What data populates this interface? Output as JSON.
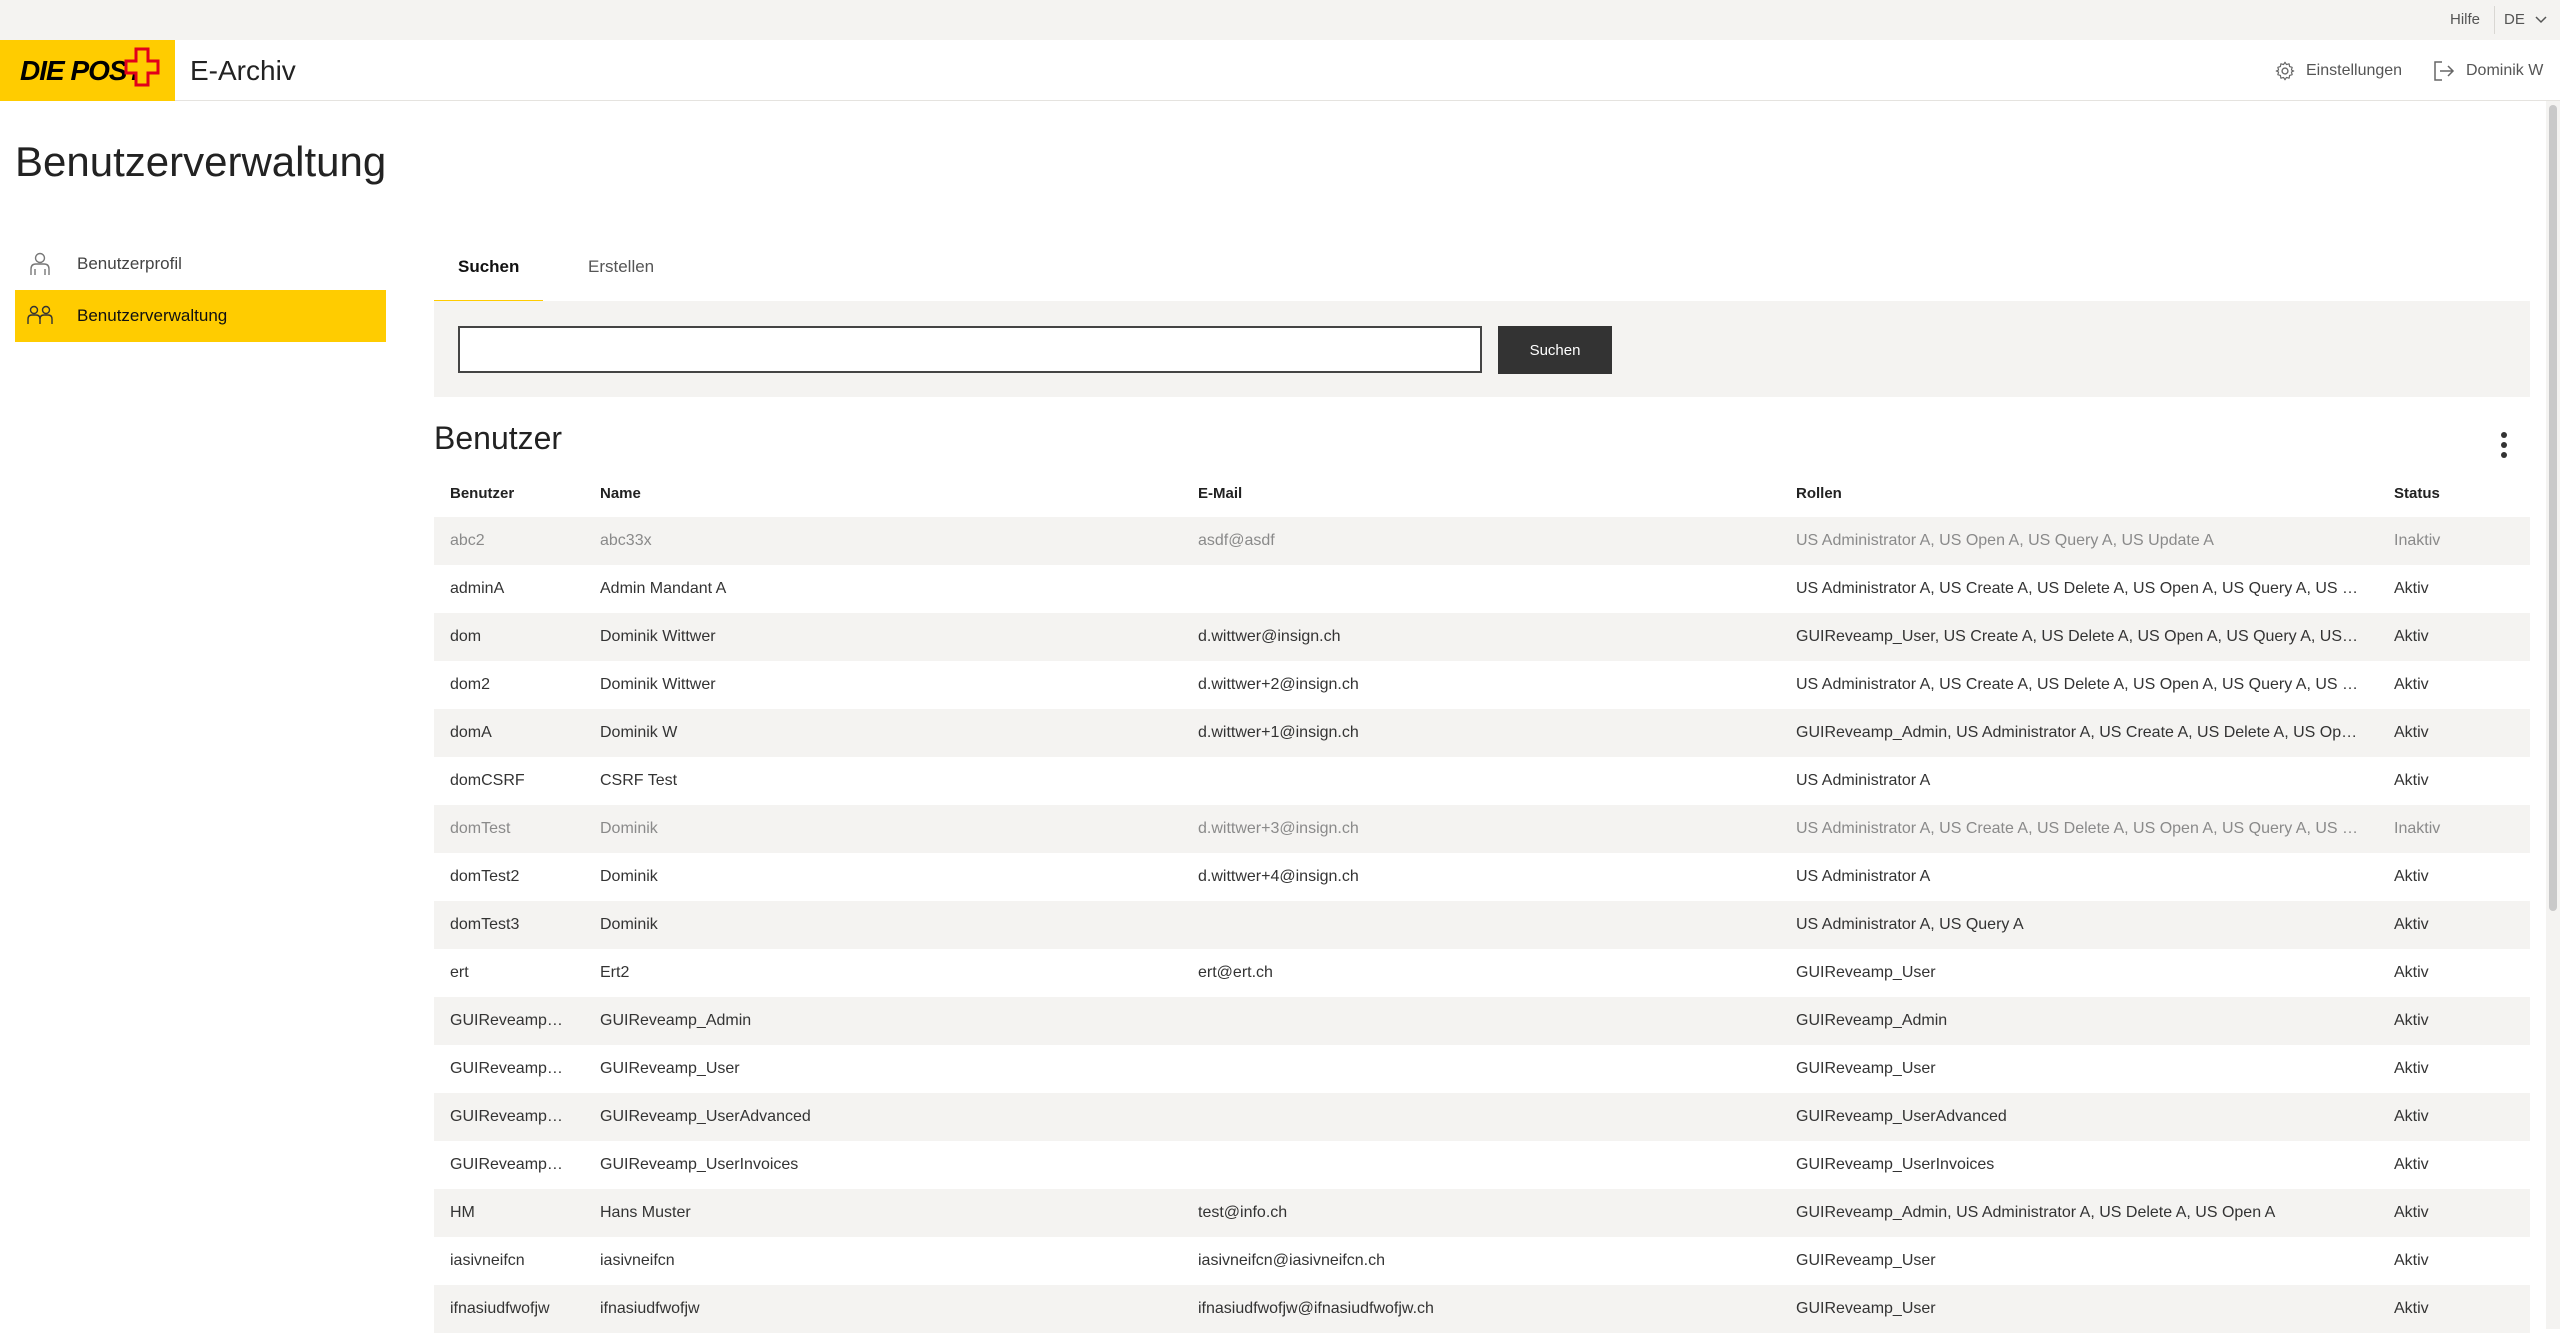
{
  "utility": {
    "help": "Hilfe",
    "language": "DE"
  },
  "header": {
    "logo_text": "DIE POST",
    "app_title": "E-Archiv",
    "settings_label": "Einstellungen",
    "user_label": "Dominik W"
  },
  "page": {
    "title": "Benutzerverwaltung"
  },
  "sidebar": {
    "items": [
      {
        "label": "Benutzerprofil",
        "icon": "user-icon",
        "active": false
      },
      {
        "label": "Benutzerverwaltung",
        "icon": "users-icon",
        "active": true
      }
    ]
  },
  "tabs": [
    {
      "label": "Suchen",
      "active": true
    },
    {
      "label": "Erstellen",
      "active": false
    }
  ],
  "search": {
    "value": "",
    "placeholder": "",
    "button_label": "Suchen"
  },
  "list": {
    "title": "Benutzer",
    "columns": [
      "Benutzer",
      "Name",
      "E-Mail",
      "Rollen",
      "Status"
    ],
    "rows": [
      {
        "user": "abc2",
        "name": "abc33x",
        "email": "asdf@asdf",
        "roles": "US Administrator A, US Open A, US Query A, US Update A",
        "status": "Inaktiv"
      },
      {
        "user": "adminA",
        "name": "Admin Mandant A",
        "email": "",
        "roles": "US Administrator A, US Create A, US Delete A, US Open A, US Query A, US Update A",
        "status": "Aktiv"
      },
      {
        "user": "dom",
        "name": "Dominik Wittwer",
        "email": "d.wittwer@insign.ch",
        "roles": "GUIReveamp_User, US Create A, US Delete A, US Open A, US Query A, US Update A",
        "status": "Aktiv"
      },
      {
        "user": "dom2",
        "name": "Dominik Wittwer",
        "email": "d.wittwer+2@insign.ch",
        "roles": "US Administrator A, US Create A, US Delete A, US Open A, US Query A, US Update A",
        "status": "Aktiv"
      },
      {
        "user": "domA",
        "name": "Dominik W",
        "email": "d.wittwer+1@insign.ch",
        "roles": "GUIReveamp_Admin, US Administrator A, US Create A, US Delete A, US Open A",
        "status": "Aktiv"
      },
      {
        "user": "domCSRF",
        "name": "CSRF Test",
        "email": "",
        "roles": "US Administrator A",
        "status": "Aktiv"
      },
      {
        "user": "domTest",
        "name": "Dominik",
        "email": "d.wittwer+3@insign.ch",
        "roles": "US Administrator A, US Create A, US Delete A, US Open A, US Query A, US Update A",
        "status": "Inaktiv"
      },
      {
        "user": "domTest2",
        "name": "Dominik",
        "email": "d.wittwer+4@insign.ch",
        "roles": "US Administrator A",
        "status": "Aktiv"
      },
      {
        "user": "domTest3",
        "name": "Dominik",
        "email": "",
        "roles": "US Administrator A, US Query A",
        "status": "Aktiv"
      },
      {
        "user": "ert",
        "name": "Ert2",
        "email": "ert@ert.ch",
        "roles": "GUIReveamp_User",
        "status": "Aktiv"
      },
      {
        "user": "GUIReveamp_Admin",
        "name": "GUIReveamp_Admin",
        "email": "",
        "roles": "GUIReveamp_Admin",
        "status": "Aktiv"
      },
      {
        "user": "GUIReveamp_User",
        "name": "GUIReveamp_User",
        "email": "",
        "roles": "GUIReveamp_User",
        "status": "Aktiv"
      },
      {
        "user": "GUIReveamp_UserAdvanced",
        "name": "GUIReveamp_UserAdvanced",
        "email": "",
        "roles": "GUIReveamp_UserAdvanced",
        "status": "Aktiv"
      },
      {
        "user": "GUIReveamp_UserInvoices",
        "name": "GUIReveamp_UserInvoices",
        "email": "",
        "roles": "GUIReveamp_UserInvoices",
        "status": "Aktiv"
      },
      {
        "user": "HM",
        "name": "Hans Muster",
        "email": "test@info.ch",
        "roles": "GUIReveamp_Admin, US Administrator A, US Delete A, US Open A",
        "status": "Aktiv"
      },
      {
        "user": "iasivneifcn",
        "name": "iasivneifcn",
        "email": "iasivneifcn@iasivneifcn.ch",
        "roles": "GUIReveamp_User",
        "status": "Aktiv"
      },
      {
        "user": "ifnasiudfwofjw",
        "name": "ifnasiudfwofjw",
        "email": "ifnasiudfwofjw@ifnasiudfwofjw.ch",
        "roles": "GUIReveamp_User",
        "status": "Aktiv"
      }
    ]
  },
  "colors": {
    "brand_yellow": "#ffcc00",
    "button_dark": "#333333",
    "stripe": "#f4f3f1"
  }
}
